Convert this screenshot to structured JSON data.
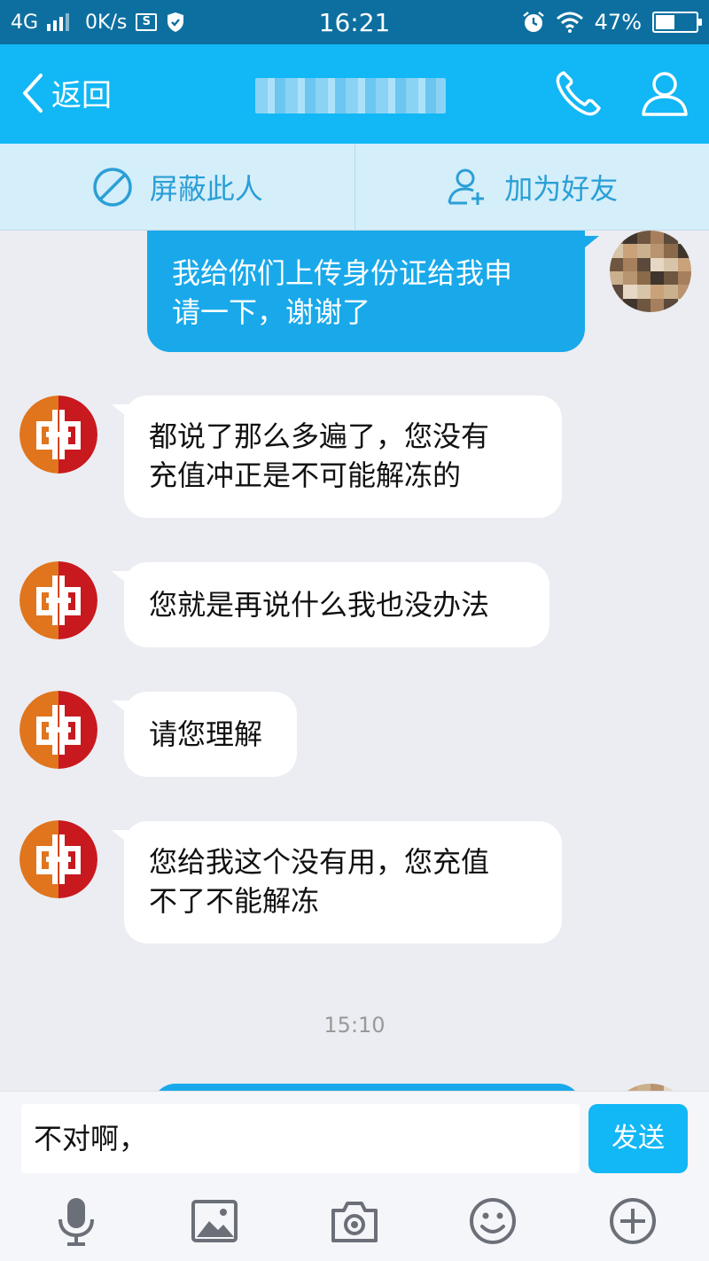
{
  "status_bar": {
    "network": "4G",
    "speed": "0K/s",
    "screenshot_glyph": "S",
    "time": "16:21",
    "battery_percent": "47%",
    "battery_level": 0.47,
    "icons": [
      "signal-icon",
      "screenshot-icon",
      "shield-icon",
      "alarm-icon",
      "wifi-icon",
      "battery-icon"
    ]
  },
  "header": {
    "back_label": "返回",
    "title": "",
    "actions": [
      "phone-icon",
      "profile-icon"
    ]
  },
  "action_bar": {
    "block_label": "屏蔽此人",
    "add_friend_label": "加为好友"
  },
  "messages": [
    {
      "side": "out",
      "lines": [
        "我给你们上传身份证给我申",
        "请一下，谢谢了"
      ]
    },
    {
      "side": "in",
      "lines": [
        "都说了那么多遍了，您没有",
        "充值冲正是不可能解冻的"
      ]
    },
    {
      "side": "in",
      "lines": [
        "您就是再说什么我也没办法"
      ]
    },
    {
      "side": "in",
      "lines": [
        "请您理解"
      ]
    },
    {
      "side": "in",
      "lines": [
        "您给我这个没有用，您充值",
        "不了不能解冻"
      ]
    }
  ],
  "timestamp": "15:10",
  "input": {
    "value": "不对啊，",
    "send_label": "发送"
  },
  "toolbar": [
    "microphone-icon",
    "image-icon",
    "camera-icon",
    "emoji-icon",
    "plus-icon"
  ],
  "colors": {
    "status_bar": "#0d6fa0",
    "header": "#12b7f5",
    "action_bar": "#d4eefa",
    "outgoing_bubble": "#19a9ea",
    "bank_orange": "#e0751e",
    "bank_red": "#c8191f"
  }
}
